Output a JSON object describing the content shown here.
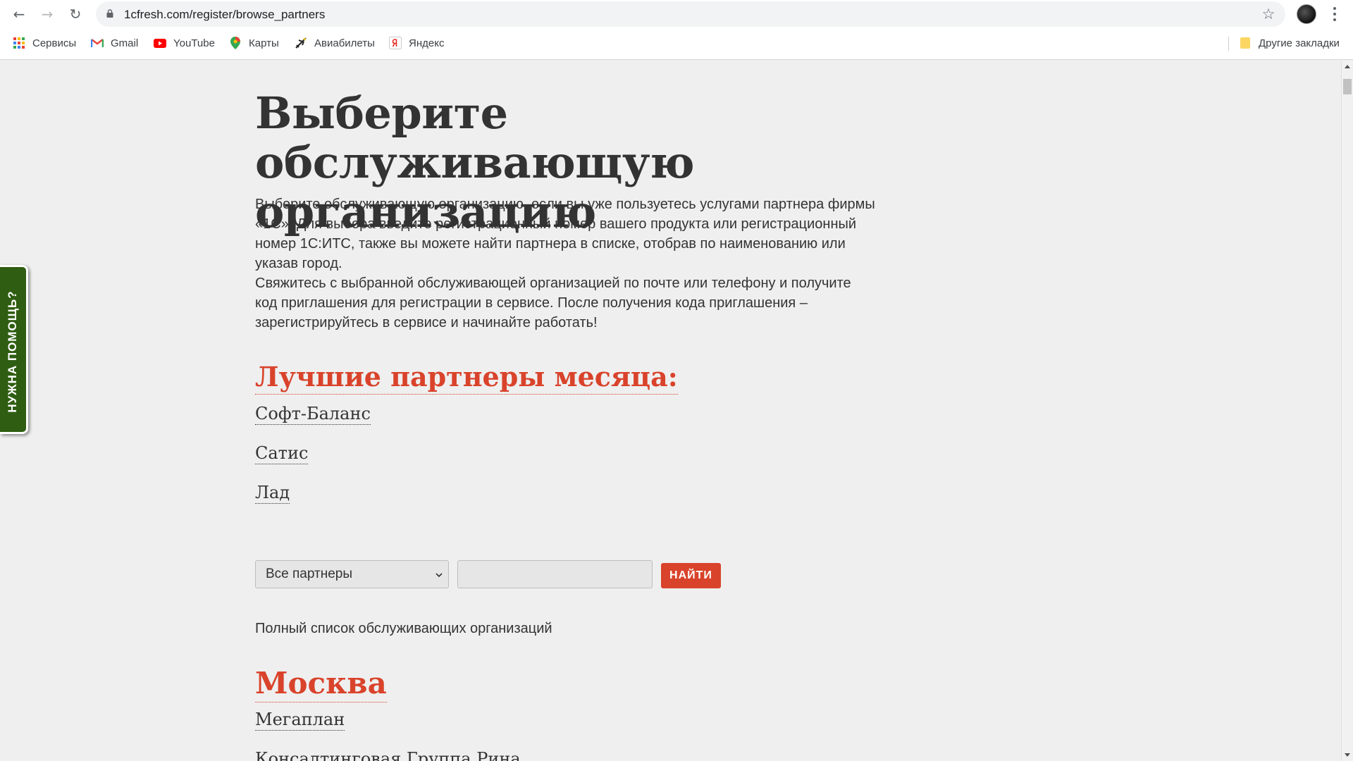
{
  "browser": {
    "url": "1cfresh.com/register/browse_partners",
    "bookmarks": [
      {
        "label": "Сервисы",
        "icon": "apps-grid-icon"
      },
      {
        "label": "Gmail",
        "icon": "gmail-icon"
      },
      {
        "label": "YouTube",
        "icon": "youtube-icon"
      },
      {
        "label": "Карты",
        "icon": "maps-pin-icon"
      },
      {
        "label": "Авиабилеты",
        "icon": "plane-icon"
      },
      {
        "label": "Яндекс",
        "icon": "yandex-icon"
      }
    ],
    "other_bookmarks": "Другие закладки"
  },
  "help_tab": {
    "label": "НУЖНА ПОМОЩЬ?"
  },
  "main": {
    "title": "Выберите обслуживающую организацию",
    "intro_1": "Выберите обслуживающую организацию, если вы уже пользуетесь услугами партнера фирмы «1С». Для выбора введите регистрационный номер вашего продукта или регистрационный номер 1С:ИТС, также вы можете найти партнера в списке, отобрав по наименованию или указав город.",
    "intro_2": "Свяжитесь с выбранной обслуживающей организацией по почте или телефону и получите код приглашения для регистрации в сервисе. После получения кода приглашения – зарегистрируйтесь в сервисе и начинайте работать!",
    "best_partners_title": "Лучшие партнеры месяца:",
    "best_partners": [
      "Софт-Баланс",
      "Сатис",
      "Лад"
    ],
    "filter": {
      "selected": "Все партнеры",
      "search_value": "",
      "button_label": "НАЙТИ"
    },
    "full_list_label": "Полный список обслуживающих организаций",
    "city": "Москва",
    "city_partners": [
      "Мегаплан",
      "Консалтинговая Группа Рина"
    ]
  },
  "colors": {
    "accent": "#d9432b",
    "help_tab_bg": "#2f5e12",
    "page_bg": "#efefef",
    "text": "#333333"
  }
}
